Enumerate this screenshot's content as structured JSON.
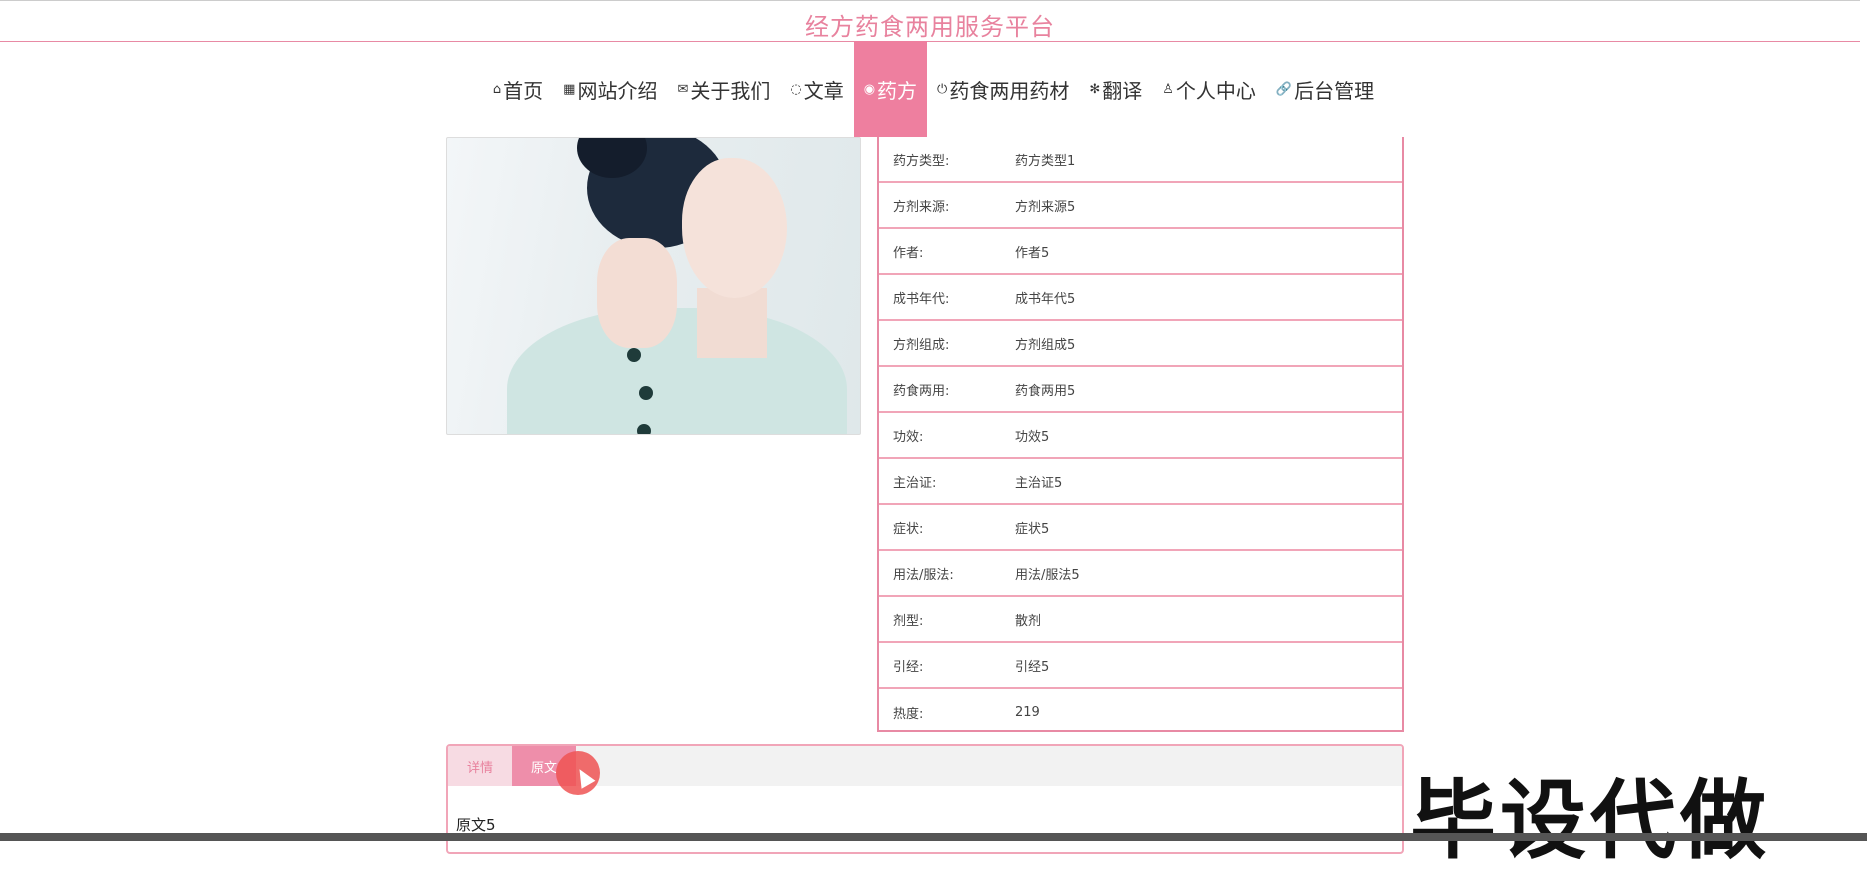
{
  "header": {
    "site_title": "经方药食两用服务平台"
  },
  "nav": {
    "items": [
      {
        "icon": "⌂",
        "label": "首页"
      },
      {
        "icon": "▦",
        "label": "网站介绍"
      },
      {
        "icon": "✉",
        "label": "关于我们"
      },
      {
        "icon": "◌",
        "label": "文章"
      },
      {
        "icon": "◉",
        "label": "药方"
      },
      {
        "icon": "⏻",
        "label": "药食两用药材"
      },
      {
        "icon": "✻",
        "label": "翻译"
      },
      {
        "icon": "♙",
        "label": "个人中心"
      },
      {
        "icon": "🔗",
        "label": "后台管理"
      }
    ],
    "active": "药方"
  },
  "detail": {
    "rows": [
      {
        "key": "药方类型:",
        "value": "药方类型1"
      },
      {
        "key": "方剂来源:",
        "value": "方剂来源5"
      },
      {
        "key": "作者:",
        "value": "作者5"
      },
      {
        "key": "成书年代:",
        "value": "成书年代5"
      },
      {
        "key": "方剂组成:",
        "value": "方剂组成5"
      },
      {
        "key": "药食两用:",
        "value": "药食两用5"
      },
      {
        "key": "功效:",
        "value": "功效5"
      },
      {
        "key": "主治证:",
        "value": "主治证5"
      },
      {
        "key": "症状:",
        "value": "症状5"
      },
      {
        "key": "用法/服法:",
        "value": "用法/服法5"
      },
      {
        "key": "剂型:",
        "value": "散剂"
      },
      {
        "key": "引经:",
        "value": "引经5"
      },
      {
        "key": "热度:",
        "value": "219"
      }
    ]
  },
  "tabs": {
    "items": [
      {
        "label": "详情"
      },
      {
        "label": "原文"
      }
    ],
    "active": "原文",
    "content": "原文5"
  },
  "watermark": "毕设代做",
  "colors": {
    "accent": "#ee7f9f",
    "border": "#e88aa4"
  }
}
